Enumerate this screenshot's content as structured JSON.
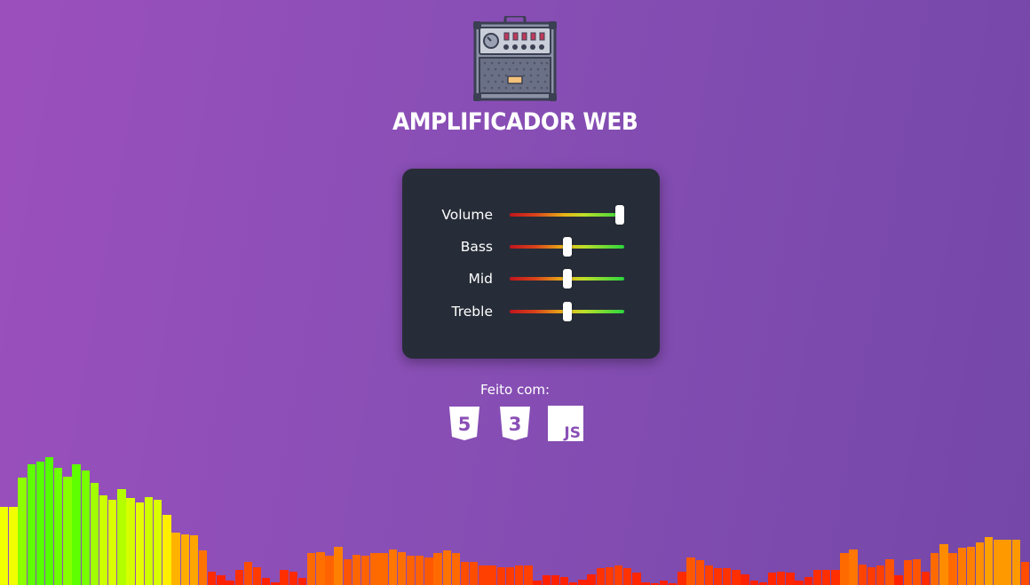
{
  "header": {
    "logo_icon": "guitar-amplifier-icon",
    "title": "AMPLIFICADOR WEB"
  },
  "controls": [
    {
      "label": "Volume",
      "value": 1.0
    },
    {
      "label": "Bass",
      "value": 0.5
    },
    {
      "label": "Mid",
      "value": 0.5
    },
    {
      "label": "Treble",
      "value": 0.5
    }
  ],
  "credits": {
    "label": "Feito com:",
    "tech": [
      {
        "name": "html5-icon",
        "glyph": "5"
      },
      {
        "name": "css3-icon",
        "glyph": "3"
      },
      {
        "name": "javascript-icon",
        "glyph": "JS"
      }
    ]
  },
  "colors": {
    "background_start": "#9b4fbd",
    "background_end": "#7447a8",
    "panel": "#272d38",
    "thumb": "#ffffff",
    "text": "#ffffff"
  },
  "visualizer": {
    "levels": [
      57,
      57,
      78,
      88,
      90,
      93,
      85,
      79,
      88,
      83,
      74,
      65,
      62,
      70,
      63,
      60,
      64,
      62,
      51,
      38,
      37,
      36,
      25,
      10,
      7,
      3,
      11,
      17,
      13,
      5,
      2,
      11,
      10,
      5,
      23,
      24,
      21,
      28,
      19,
      22,
      21,
      23,
      23,
      26,
      24,
      21,
      21,
      20,
      23,
      25,
      23,
      17,
      17,
      14,
      14,
      13,
      13,
      14,
      14,
      3,
      7,
      7,
      6,
      2,
      4,
      8,
      12,
      13,
      14,
      12,
      9,
      2,
      1,
      3,
      1,
      10,
      20,
      18,
      14,
      12,
      12,
      11,
      8,
      3,
      2,
      9,
      10,
      9,
      3,
      6,
      11,
      11,
      11,
      23,
      26,
      15,
      13,
      14,
      19,
      7,
      18,
      19,
      10,
      23,
      30,
      23,
      27,
      28,
      31,
      35,
      33,
      33,
      33,
      17
    ]
  }
}
